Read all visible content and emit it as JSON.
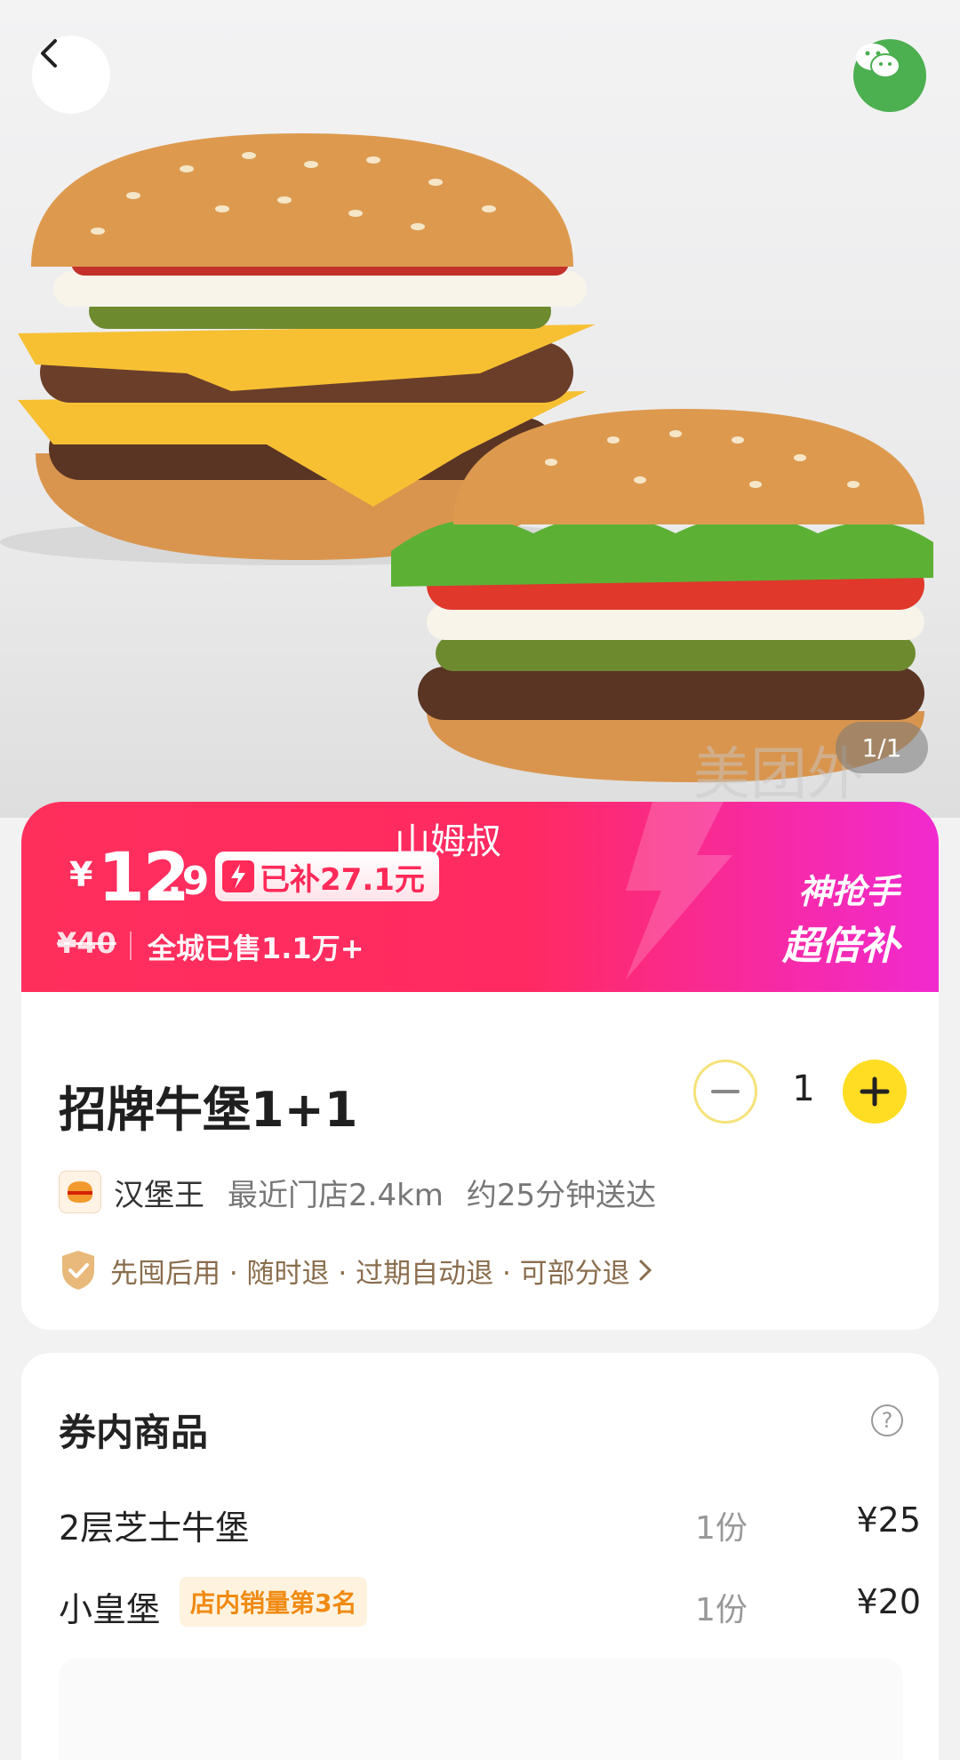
{
  "nav": {
    "page_indicator": "1/1",
    "watermark": "美团外"
  },
  "banner": {
    "overlay_name": "山姆叔",
    "currency": "¥",
    "price_int": "12",
    "price_dec": ".9",
    "subsidy": "已补27.1元",
    "original_price": "¥40",
    "sold": "全城已售1.1万+",
    "promo_line1": "神抢手",
    "promo_line2": "超倍补"
  },
  "product": {
    "title": "招牌牛堡1+1",
    "quantity": "1",
    "store_name": "汉堡王",
    "store_logo_text": "汉堡王",
    "distance": "最近门店2.4km",
    "eta": "约25分钟送达",
    "policy": "先囤后用 · 随时退 · 过期自动退 · 可部分退"
  },
  "coupon": {
    "title": "券内商品",
    "help": "?",
    "items": [
      {
        "name": "2层芝士牛堡",
        "badge": "",
        "qty": "1份",
        "price": "¥25"
      },
      {
        "name": "小皇堡",
        "badge": "店内销量第3名",
        "qty": "1份",
        "price": "¥20"
      }
    ]
  },
  "colors": {
    "banner_start": "#ff2f5c",
    "banner_end": "#f12ad0",
    "accent_yellow": "#ffdd22",
    "wechat_green": "#4caf50"
  }
}
